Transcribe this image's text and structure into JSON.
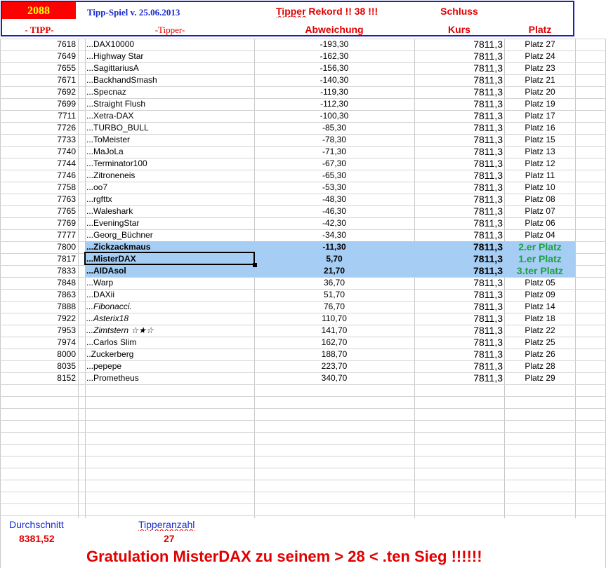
{
  "header": {
    "tip_number": "2088",
    "tip_label": "- TIPP-",
    "game_title": "Tipp-Spiel v. 25.06.2013",
    "tipper_label": "-Tipper-",
    "record_prefix": "Tipper",
    "record_text": "Rekord !!  38  !!!",
    "deviation_label": "Abweichung",
    "close_label": "Schluss",
    "price_label": "Kurs",
    "place_label": "Platz"
  },
  "rows": [
    {
      "tipp": "7618",
      "name": "...DAX10000",
      "dev": "-193,30",
      "kurs": "7811,3",
      "platz": "Platz 27"
    },
    {
      "tipp": "7649",
      "name": "...Highway Star",
      "dev": "-162,30",
      "kurs": "7811,3",
      "platz": "Platz 24"
    },
    {
      "tipp": "7655",
      "name": "...SagittariusA",
      "dev": "-156,30",
      "kurs": "7811,3",
      "platz": "Platz 23"
    },
    {
      "tipp": "7671",
      "name": "...BackhandSmash",
      "dev": "-140,30",
      "kurs": "7811,3",
      "platz": "Platz 21"
    },
    {
      "tipp": "7692",
      "name": "...Specnaz",
      "dev": "-119,30",
      "kurs": "7811,3",
      "platz": "Platz 20"
    },
    {
      "tipp": "7699",
      "name": "...Straight Flush",
      "dev": "-112,30",
      "kurs": "7811,3",
      "platz": "Platz 19"
    },
    {
      "tipp": "7711",
      "name": "...Xetra-DAX",
      "dev": "-100,30",
      "kurs": "7811,3",
      "platz": "Platz 17"
    },
    {
      "tipp": "7726",
      "name": "...TURBO_BULL",
      "dev": "-85,30",
      "kurs": "7811,3",
      "platz": "Platz 16"
    },
    {
      "tipp": "7733",
      "name": "...ToMeister",
      "dev": "-78,30",
      "kurs": "7811,3",
      "platz": "Platz 15"
    },
    {
      "tipp": "7740",
      "name": "...MaJoLa",
      "dev": "-71,30",
      "kurs": "7811,3",
      "platz": "Platz 13"
    },
    {
      "tipp": "7744",
      "name": "...Terminator100",
      "dev": "-67,30",
      "kurs": "7811,3",
      "platz": "Platz 12"
    },
    {
      "tipp": "7746",
      "name": "...Zitroneneis",
      "dev": "-65,30",
      "kurs": "7811,3",
      "platz": "Platz 11"
    },
    {
      "tipp": "7758",
      "name": "...oo7",
      "dev": "-53,30",
      "kurs": "7811,3",
      "platz": "Platz 10"
    },
    {
      "tipp": "7763",
      "name": "...rgfttx",
      "dev": "-48,30",
      "kurs": "7811,3",
      "platz": "Platz 08"
    },
    {
      "tipp": "7765",
      "name": "...Waleshark",
      "dev": "-46,30",
      "kurs": "7811,3",
      "platz": "Platz 07"
    },
    {
      "tipp": "7769",
      "name": "...EveningStar",
      "dev": "-42,30",
      "kurs": "7811,3",
      "platz": "Platz 06"
    },
    {
      "tipp": "7777",
      "name": "...Georg_Büchner",
      "dev": "-34,30",
      "kurs": "7811,3",
      "platz": "Platz 04"
    },
    {
      "tipp": "7800",
      "name": "...Zickzackmaus",
      "dev": "-11,30",
      "kurs": "7811,3",
      "platz": "2.er Platz",
      "winner": true
    },
    {
      "tipp": "7817",
      "name": "...MisterDAX",
      "dev": "5,70",
      "kurs": "7811,3",
      "platz": "1.er Platz",
      "winner": true
    },
    {
      "tipp": "7833",
      "name": "...AIDAsol",
      "dev": "21,70",
      "kurs": "7811,3",
      "platz": "3.ter Platz",
      "winner": true
    },
    {
      "tipp": "7848",
      "name": "...Warp",
      "dev": "36,70",
      "kurs": "7811,3",
      "platz": "Platz 05"
    },
    {
      "tipp": "7863",
      "name": "...DAXii",
      "dev": "51,70",
      "kurs": "7811,3",
      "platz": "Platz 09"
    },
    {
      "tipp": "7888",
      "name": "...Fibonacci.",
      "dev": "76,70",
      "kurs": "7811,3",
      "platz": "Platz 14",
      "italic": true
    },
    {
      "tipp": "7922",
      "name": "...Asterix18",
      "dev": "110,70",
      "kurs": "7811,3",
      "platz": "Platz 18",
      "italic": true
    },
    {
      "tipp": "7953",
      "name": "...Zimtstern  ☆★☆",
      "dev": "141,70",
      "kurs": "7811,3",
      "platz": "Platz 22",
      "italic": true
    },
    {
      "tipp": "7974",
      "name": "...Carlos Slim",
      "dev": "162,70",
      "kurs": "7811,3",
      "platz": "Platz 25"
    },
    {
      "tipp": "8000",
      "name": "..Zuckerberg",
      "dev": "188,70",
      "kurs": "7811,3",
      "platz": "Platz 26"
    },
    {
      "tipp": "8035",
      "name": "...pepepe",
      "dev": "223,70",
      "kurs": "7811,3",
      "platz": "Platz 28"
    },
    {
      "tipp": "8152",
      "name": "...Prometheus",
      "dev": "340,70",
      "kurs": "7811,3",
      "platz": "Platz 29"
    }
  ],
  "footer": {
    "avg_label": "Durchschnitt",
    "avg_value": "8381,52",
    "count_label": "Tipperanzahl",
    "count_value": "27",
    "congrats": "Gratulation MisterDAX zu seinem > 28 < .ten Sieg !!!!!!"
  },
  "colors": {
    "tip_box": "#ff0000",
    "tip_number_text": "#ffff00",
    "header_border": "#1f1fb5",
    "highlight_rows": "#a6cdf4",
    "winner_text": "#1aa23a",
    "red_text": "#e00000",
    "blue_text": "#1a2bd0"
  }
}
